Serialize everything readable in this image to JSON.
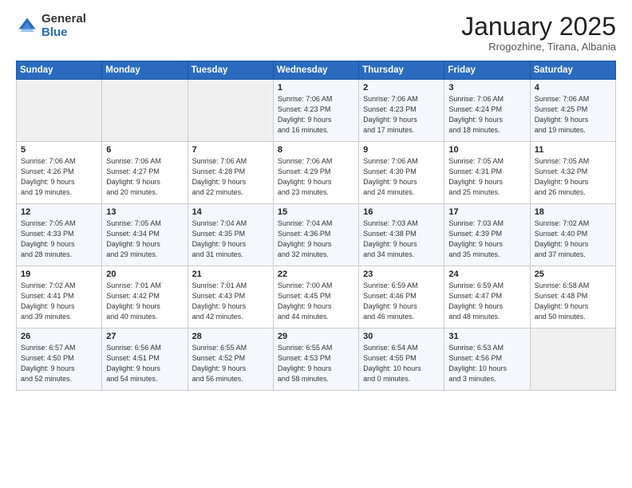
{
  "header": {
    "logo_general": "General",
    "logo_blue": "Blue",
    "month_title": "January 2025",
    "subtitle": "Rrogozhine, Tirana, Albania"
  },
  "weekdays": [
    "Sunday",
    "Monday",
    "Tuesday",
    "Wednesday",
    "Thursday",
    "Friday",
    "Saturday"
  ],
  "weeks": [
    [
      {
        "day": "",
        "info": ""
      },
      {
        "day": "",
        "info": ""
      },
      {
        "day": "",
        "info": ""
      },
      {
        "day": "1",
        "info": "Sunrise: 7:06 AM\nSunset: 4:23 PM\nDaylight: 9 hours\nand 16 minutes."
      },
      {
        "day": "2",
        "info": "Sunrise: 7:06 AM\nSunset: 4:23 PM\nDaylight: 9 hours\nand 17 minutes."
      },
      {
        "day": "3",
        "info": "Sunrise: 7:06 AM\nSunset: 4:24 PM\nDaylight: 9 hours\nand 18 minutes."
      },
      {
        "day": "4",
        "info": "Sunrise: 7:06 AM\nSunset: 4:25 PM\nDaylight: 9 hours\nand 19 minutes."
      }
    ],
    [
      {
        "day": "5",
        "info": "Sunrise: 7:06 AM\nSunset: 4:26 PM\nDaylight: 9 hours\nand 19 minutes."
      },
      {
        "day": "6",
        "info": "Sunrise: 7:06 AM\nSunset: 4:27 PM\nDaylight: 9 hours\nand 20 minutes."
      },
      {
        "day": "7",
        "info": "Sunrise: 7:06 AM\nSunset: 4:28 PM\nDaylight: 9 hours\nand 22 minutes."
      },
      {
        "day": "8",
        "info": "Sunrise: 7:06 AM\nSunset: 4:29 PM\nDaylight: 9 hours\nand 23 minutes."
      },
      {
        "day": "9",
        "info": "Sunrise: 7:06 AM\nSunset: 4:30 PM\nDaylight: 9 hours\nand 24 minutes."
      },
      {
        "day": "10",
        "info": "Sunrise: 7:05 AM\nSunset: 4:31 PM\nDaylight: 9 hours\nand 25 minutes."
      },
      {
        "day": "11",
        "info": "Sunrise: 7:05 AM\nSunset: 4:32 PM\nDaylight: 9 hours\nand 26 minutes."
      }
    ],
    [
      {
        "day": "12",
        "info": "Sunrise: 7:05 AM\nSunset: 4:33 PM\nDaylight: 9 hours\nand 28 minutes."
      },
      {
        "day": "13",
        "info": "Sunrise: 7:05 AM\nSunset: 4:34 PM\nDaylight: 9 hours\nand 29 minutes."
      },
      {
        "day": "14",
        "info": "Sunrise: 7:04 AM\nSunset: 4:35 PM\nDaylight: 9 hours\nand 31 minutes."
      },
      {
        "day": "15",
        "info": "Sunrise: 7:04 AM\nSunset: 4:36 PM\nDaylight: 9 hours\nand 32 minutes."
      },
      {
        "day": "16",
        "info": "Sunrise: 7:03 AM\nSunset: 4:38 PM\nDaylight: 9 hours\nand 34 minutes."
      },
      {
        "day": "17",
        "info": "Sunrise: 7:03 AM\nSunset: 4:39 PM\nDaylight: 9 hours\nand 35 minutes."
      },
      {
        "day": "18",
        "info": "Sunrise: 7:02 AM\nSunset: 4:40 PM\nDaylight: 9 hours\nand 37 minutes."
      }
    ],
    [
      {
        "day": "19",
        "info": "Sunrise: 7:02 AM\nSunset: 4:41 PM\nDaylight: 9 hours\nand 39 minutes."
      },
      {
        "day": "20",
        "info": "Sunrise: 7:01 AM\nSunset: 4:42 PM\nDaylight: 9 hours\nand 40 minutes."
      },
      {
        "day": "21",
        "info": "Sunrise: 7:01 AM\nSunset: 4:43 PM\nDaylight: 9 hours\nand 42 minutes."
      },
      {
        "day": "22",
        "info": "Sunrise: 7:00 AM\nSunset: 4:45 PM\nDaylight: 9 hours\nand 44 minutes."
      },
      {
        "day": "23",
        "info": "Sunrise: 6:59 AM\nSunset: 4:46 PM\nDaylight: 9 hours\nand 46 minutes."
      },
      {
        "day": "24",
        "info": "Sunrise: 6:59 AM\nSunset: 4:47 PM\nDaylight: 9 hours\nand 48 minutes."
      },
      {
        "day": "25",
        "info": "Sunrise: 6:58 AM\nSunset: 4:48 PM\nDaylight: 9 hours\nand 50 minutes."
      }
    ],
    [
      {
        "day": "26",
        "info": "Sunrise: 6:57 AM\nSunset: 4:50 PM\nDaylight: 9 hours\nand 52 minutes."
      },
      {
        "day": "27",
        "info": "Sunrise: 6:56 AM\nSunset: 4:51 PM\nDaylight: 9 hours\nand 54 minutes."
      },
      {
        "day": "28",
        "info": "Sunrise: 6:55 AM\nSunset: 4:52 PM\nDaylight: 9 hours\nand 56 minutes."
      },
      {
        "day": "29",
        "info": "Sunrise: 6:55 AM\nSunset: 4:53 PM\nDaylight: 9 hours\nand 58 minutes."
      },
      {
        "day": "30",
        "info": "Sunrise: 6:54 AM\nSunset: 4:55 PM\nDaylight: 10 hours\nand 0 minutes."
      },
      {
        "day": "31",
        "info": "Sunrise: 6:53 AM\nSunset: 4:56 PM\nDaylight: 10 hours\nand 3 minutes."
      },
      {
        "day": "",
        "info": ""
      }
    ]
  ]
}
